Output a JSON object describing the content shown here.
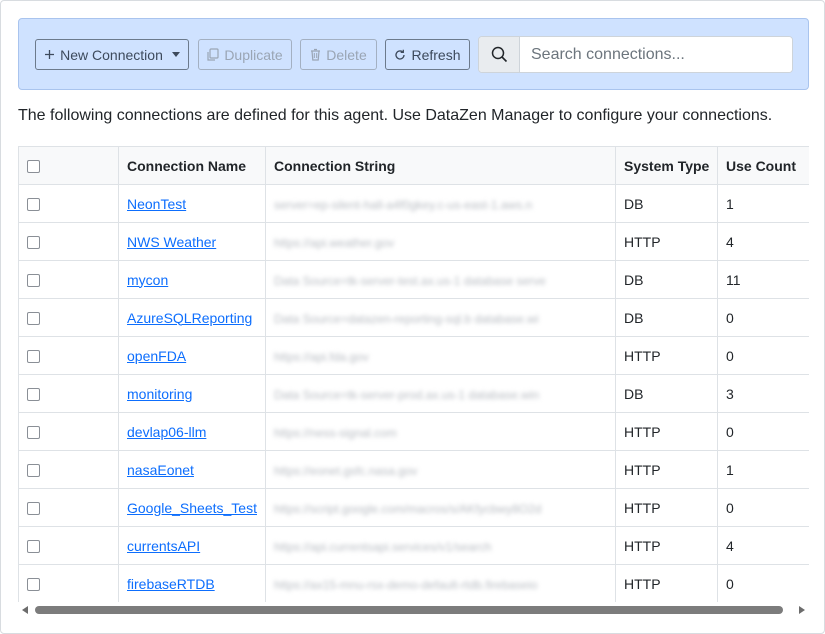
{
  "toolbar": {
    "new_connection_label": "New Connection",
    "duplicate_label": "Duplicate",
    "delete_label": "Delete",
    "refresh_label": "Refresh",
    "search_placeholder": "Search connections..."
  },
  "description": "The following connections are defined for this agent. Use DataZen Manager to configure your connections.",
  "table": {
    "columns": [
      "Connection Name",
      "Connection String",
      "System Type",
      "Use Count"
    ],
    "rows": [
      {
        "name": "NeonTest",
        "conn": "server=ep-silent-hall-a4f0gkey.c-us-east-1.aws.n",
        "type": "DB",
        "count": "1"
      },
      {
        "name": "NWS Weather",
        "conn": "https://api.weather.gov",
        "type": "HTTP",
        "count": "4"
      },
      {
        "name": "mycon",
        "conn": "Data Source=tk-server-test.ax.us-1 database serve",
        "type": "DB",
        "count": "11"
      },
      {
        "name": "AzureSQLReporting",
        "conn": "Data Source=datazen-reporting-sql.b database.wi",
        "type": "DB",
        "count": "0"
      },
      {
        "name": "openFDA",
        "conn": "https://api.fda.gov",
        "type": "HTTP",
        "count": "0"
      },
      {
        "name": "monitoring",
        "conn": "Data Source=tk-server-prod.ax.us-1 database.win",
        "type": "DB",
        "count": "3"
      },
      {
        "name": "devlap06-llm",
        "conn": "https://ness-signal.com",
        "type": "HTTP",
        "count": "0"
      },
      {
        "name": "nasaEonet",
        "conn": "https://eonet.gsfc.nasa.gov",
        "type": "HTTP",
        "count": "1"
      },
      {
        "name": "Google_Sheets_Test",
        "conn": "https://script.google.com/macros/s/AKfycbwy8O2d",
        "type": "HTTP",
        "count": "0"
      },
      {
        "name": "currentsAPI",
        "conn": "https://api.currentsapi.services/v1/search",
        "type": "HTTP",
        "count": "4"
      },
      {
        "name": "firebaseRTDB",
        "conn": "https://ax15-mnu-rsx-demo-default-rtdb.firebaseio",
        "type": "HTTP",
        "count": "0"
      }
    ]
  }
}
